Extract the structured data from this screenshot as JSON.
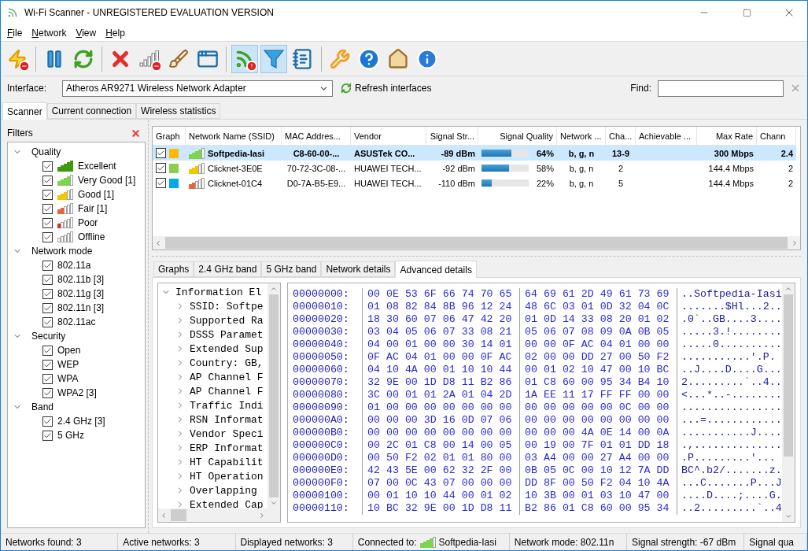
{
  "window": {
    "title": "Wi-Fi Scanner - UNREGISTERED EVALUATION VERSION"
  },
  "menu": [
    {
      "label": "File"
    },
    {
      "label": "Network"
    },
    {
      "label": "View"
    },
    {
      "label": "Help"
    }
  ],
  "toolbar": [
    {
      "kind": "power-off",
      "pressed": false
    },
    {
      "kind": "separator"
    },
    {
      "kind": "pause",
      "pressed": false
    },
    {
      "kind": "refresh",
      "pressed": false
    },
    {
      "kind": "separator"
    },
    {
      "kind": "delete",
      "pressed": false
    },
    {
      "kind": "signal-off",
      "pressed": false
    },
    {
      "kind": "broom",
      "pressed": false
    },
    {
      "kind": "window",
      "pressed": false
    },
    {
      "kind": "separator"
    },
    {
      "kind": "feed-alert",
      "pressed": true
    },
    {
      "kind": "filter",
      "pressed": true
    },
    {
      "kind": "notebook",
      "pressed": false
    },
    {
      "kind": "separator"
    },
    {
      "kind": "wrench",
      "pressed": false
    },
    {
      "kind": "help",
      "pressed": false
    },
    {
      "kind": "home",
      "pressed": false
    },
    {
      "kind": "info",
      "pressed": false
    }
  ],
  "interface": {
    "label": "Interface:",
    "value": "Atheros AR9271 Wireless Network Adapter",
    "refresh": "Refresh interfaces"
  },
  "find": {
    "label": "Find:"
  },
  "tabs": [
    {
      "label": "Scanner",
      "selected": true
    },
    {
      "label": "Current connection",
      "selected": false
    },
    {
      "label": "Wireless statistics",
      "selected": false
    }
  ],
  "filters": {
    "title": "Filters",
    "groups": [
      {
        "label": "Quality",
        "expanded": true,
        "children": [
          {
            "label": "Excellent",
            "checked": true,
            "color": "#3c9a0e"
          },
          {
            "label": "Very Good [1]",
            "checked": true,
            "color": "#7ed34f"
          },
          {
            "label": "Good [1]",
            "checked": true,
            "color": "#f0c800"
          },
          {
            "label": "Fair [1]",
            "checked": true,
            "color": "#e8643c"
          },
          {
            "label": "Poor",
            "checked": true,
            "color": "#d83030"
          },
          {
            "label": "Offline",
            "checked": true,
            "color": "#a0a0a0"
          }
        ]
      },
      {
        "label": "Network mode",
        "expanded": true,
        "children": [
          {
            "label": "802.11a",
            "checked": true
          },
          {
            "label": "802.11b [3]",
            "checked": true
          },
          {
            "label": "802.11g [3]",
            "checked": true
          },
          {
            "label": "802.11n [3]",
            "checked": true
          },
          {
            "label": "802.11ac",
            "checked": true
          }
        ]
      },
      {
        "label": "Security",
        "expanded": true,
        "children": [
          {
            "label": "Open",
            "checked": true
          },
          {
            "label": "WEP",
            "checked": true
          },
          {
            "label": "WPA",
            "checked": true
          },
          {
            "label": "WPA2 [3]",
            "checked": true
          }
        ]
      },
      {
        "label": "Band",
        "expanded": true,
        "children": [
          {
            "label": "2.4 GHz [3]",
            "checked": true
          },
          {
            "label": "5 GHz",
            "checked": true
          }
        ]
      }
    ]
  },
  "networks": {
    "columns": [
      "Graph",
      "Network Name (SSID)",
      "MAC Addres...",
      "Vendor",
      "Signal Str...",
      "Signal Quality",
      "Network ...",
      "Cha...",
      "Achievable ...",
      "Max Rate",
      "Chann"
    ],
    "rows": [
      {
        "checked": true,
        "selected": true,
        "color": "#ffb900",
        "ssid": "Softpedia-Iasi",
        "mac": "C8-60-00-...",
        "vendor": "ASUSTek CO...",
        "strength": "-89 dBm",
        "level": 0.64,
        "quality": "64%",
        "mode": "b, g, n",
        "channel": "13-9",
        "max_rate": "300 Mbps",
        "column_11": "2.4"
      },
      {
        "checked": true,
        "selected": false,
        "color": "#8cd04a",
        "ssid": "Clicknet-3E0E",
        "mac": "70-72-3C-08-...",
        "vendor": "HUAWEI TECH...",
        "strength": "-92 dBm",
        "level": 0.58,
        "quality": "58%",
        "mode": "b, g, n",
        "channel": "2",
        "max_rate": "144.4 Mbps",
        "column_11": "2"
      },
      {
        "checked": true,
        "selected": false,
        "color": "#00a8f0",
        "ssid": "Clicknet-01C4",
        "mac": "D0-7A-B5-E9...",
        "vendor": "HUAWEI TECH...",
        "strength": "-110 dBm",
        "level": 0.22,
        "quality": "22%",
        "mode": "b, g, n",
        "channel": "5",
        "max_rate": "144.4 Mbps",
        "column_11": "2"
      }
    ]
  },
  "detail_tabs": [
    {
      "label": "Graphs",
      "selected": false
    },
    {
      "label": "2.4 GHz band",
      "selected": false
    },
    {
      "label": "5 GHz band",
      "selected": false
    },
    {
      "label": "Network details",
      "selected": false
    },
    {
      "label": "Advanced details",
      "selected": true
    }
  ],
  "elements_tree": {
    "label": "Information El",
    "expanded": true,
    "children": [
      {
        "label": "SSID: Softpe",
        "expanded": false
      },
      {
        "label": "Supported Ra",
        "expanded": false
      },
      {
        "label": "DSSS Paramet",
        "expanded": false
      },
      {
        "label": "Extended Sup",
        "expanded": false
      },
      {
        "label": "Country: GB,",
        "expanded": false
      },
      {
        "label": "AP Channel F",
        "expanded": false
      },
      {
        "label": "AP Channel F",
        "expanded": false
      },
      {
        "label": "Traffic Indi",
        "expanded": false
      },
      {
        "label": "RSN Informat",
        "expanded": false
      },
      {
        "label": "Vendor Speci",
        "expanded": false
      },
      {
        "label": "ERP Informat",
        "expanded": false
      },
      {
        "label": "HT Capabilit",
        "expanded": false
      },
      {
        "label": "HT Operation",
        "expanded": false
      },
      {
        "label": "Overlapping",
        "expanded": false
      },
      {
        "label": "Extended Cap",
        "expanded": false
      }
    ]
  },
  "hex_dump": [
    {
      "offset": "00000000:",
      "bytes_1": "00 0E 53 6F 66 74 70 65",
      "bytes_2": "64 69 61 2D 49 61 73 69",
      "ascii": "..Softpedia-Iasi"
    },
    {
      "offset": "00000010:",
      "bytes_1": "01 08 82 84 8B 96 12 24",
      "bytes_2": "48 6C 03 01 0D 32 04 0C",
      "ascii": ".......$Hl...2.."
    },
    {
      "offset": "00000020:",
      "bytes_1": "18 30 60 07 06 47 42 20",
      "bytes_2": "01 0D 14 33 08 20 01 02",
      "ascii": ".0`..GB....3...."
    },
    {
      "offset": "00000030:",
      "bytes_1": "03 04 05 06 07 33 08 21",
      "bytes_2": "05 06 07 08 09 0A 0B 05",
      "ascii": ".....3.!........"
    },
    {
      "offset": "00000040:",
      "bytes_1": "04 00 01 00 00 30 14 01",
      "bytes_2": "00 00 0F AC 04 01 00 00",
      "ascii": ".....0.........."
    },
    {
      "offset": "00000050:",
      "bytes_1": "0F AC 04 01 00 00 0F AC",
      "bytes_2": "02 00 00 DD 27 00 50 F2",
      "ascii": "...........'.P."
    },
    {
      "offset": "00000060:",
      "bytes_1": "04 10 4A 00 01 10 10 44",
      "bytes_2": "00 01 02 10 47 00 10 BC",
      "ascii": "..J....D....G..."
    },
    {
      "offset": "00000070:",
      "bytes_1": "32 9E 00 1D D8 11 B2 86",
      "bytes_2": "01 C8 60 00 95 34 B4 10",
      "ascii": "2.........`..4.."
    },
    {
      "offset": "00000080:",
      "bytes_1": "3C 00 01 01 2A 01 04 2D",
      "bytes_2": "1A EE 11 17 FF FF 00 00",
      "ascii": "<...*..-........"
    },
    {
      "offset": "00000090:",
      "bytes_1": "01 00 00 00 00 00 00 00",
      "bytes_2": "00 00 00 00 00 0C 00 00",
      "ascii": "................"
    },
    {
      "offset": "000000A0:",
      "bytes_1": "00 00 00 3D 16 0D 07 06",
      "bytes_2": "00 00 00 00 00 00 00 00",
      "ascii": "...=............"
    },
    {
      "offset": "000000B0:",
      "bytes_1": "00 00 00 00 00 00 00 00",
      "bytes_2": "00 00 00 4A 0E 14 00 0A",
      "ascii": "...........J...."
    },
    {
      "offset": "000000C0:",
      "bytes_1": "00 2C 01 C8 00 14 00 05",
      "bytes_2": "00 19 00 7F 01 01 DD 18",
      "ascii": ".,.............."
    },
    {
      "offset": "000000D0:",
      "bytes_1": "00 50 F2 02 01 01 80 00",
      "bytes_2": "03 A4 00 00 27 A4 00 00",
      "ascii": ".P.........'..."
    },
    {
      "offset": "000000E0:",
      "bytes_1": "42 43 5E 00 62 32 2F 00",
      "bytes_2": "0B 05 0C 00 10 12 7A DD",
      "ascii": "BC^.b2/.......z."
    },
    {
      "offset": "000000F0:",
      "bytes_1": "07 00 0C 43 07 00 00 00",
      "bytes_2": "DD 8F 00 50 F2 04 10 4A",
      "ascii": "...C.......P...J"
    },
    {
      "offset": "00000100:",
      "bytes_1": "00 01 10 10 44 00 01 02",
      "bytes_2": "10 3B 00 01 03 10 47 00",
      "ascii": "....D....;....G."
    },
    {
      "offset": "00000110:",
      "bytes_1": "10 BC 32 9E 00 1D D8 11",
      "bytes_2": "B2 86 01 C8 60 00 95 34",
      "ascii": "..2.........`..4"
    }
  ],
  "status_bar": {
    "networks_found": "Networks found: 3",
    "active": "Active networks: 3",
    "displayed": "Displayed networks: 3",
    "connected_label": "Connected to:",
    "connected_ssid": "Softpedia-Iasi",
    "mode": "Network mode: 802.11n",
    "strength": "Signal strength: -67 dBm",
    "quality": "Signal qua"
  }
}
